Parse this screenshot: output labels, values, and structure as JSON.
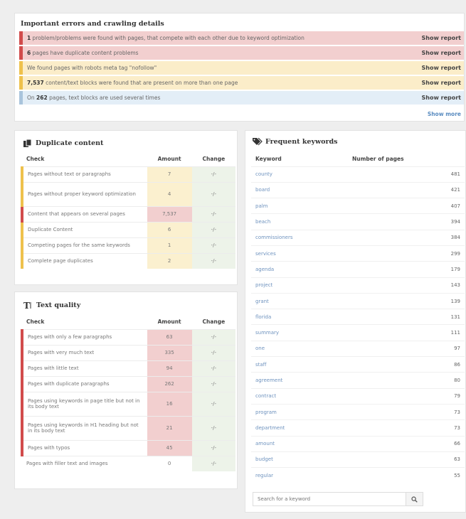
{
  "errors": {
    "title": "Important errors and crawling details",
    "show_label": "Show report",
    "show_more": "Show more",
    "rows": [
      {
        "bold": "1",
        "text": " problem/problems were found with pages, that compete with each other due to keyword optimization",
        "status": "red"
      },
      {
        "bold": "6",
        "text": " pages have duplicate content problems",
        "status": "red"
      },
      {
        "bold": "",
        "text": "We found pages with robots meta tag \"nofollow\"",
        "status": "yellow"
      },
      {
        "bold": "7,537",
        "text": " content/text blocks were found that are present on more than one page",
        "status": "yellow"
      },
      {
        "bold": "262",
        "text": " pages, text blocks are used several times",
        "prefix": "On ",
        "status": "blue"
      }
    ]
  },
  "duplicate": {
    "title": "Duplicate content",
    "col_check": "Check",
    "col_amount": "Amount",
    "col_change": "Change",
    "rows": [
      {
        "check": "Pages without text or paragraphs",
        "amount": "7",
        "change": "-/-",
        "status": "yellow"
      },
      {
        "check": "Pages without proper keyword optimization",
        "amount": "4",
        "change": "-/-",
        "status": "yellow"
      },
      {
        "check": "Content that appears on several pages",
        "amount": "7,537",
        "change": "-/-",
        "status": "red"
      },
      {
        "check": "Duplicate Content",
        "amount": "6",
        "change": "-/-",
        "status": "yellow"
      },
      {
        "check": "Competing pages for the same keywords",
        "amount": "1",
        "change": "-/-",
        "status": "yellow"
      },
      {
        "check": "Complete page duplicates",
        "amount": "2",
        "change": "-/-",
        "status": "yellow"
      }
    ]
  },
  "text_quality": {
    "title": "Text quality",
    "col_check": "Check",
    "col_amount": "Amount",
    "col_change": "Change",
    "rows": [
      {
        "check": "Pages with only a few paragraphs",
        "amount": "63",
        "change": "-/-",
        "status": "red"
      },
      {
        "check": "Pages with very much text",
        "amount": "335",
        "change": "-/-",
        "status": "red"
      },
      {
        "check": "Pages with little text",
        "amount": "94",
        "change": "-/-",
        "status": "red"
      },
      {
        "check": "Pages with duplicate paragraphs",
        "amount": "262",
        "change": "-/-",
        "status": "red"
      },
      {
        "check": "Pages using keywords in page title but not in its body text",
        "amount": "16",
        "change": "-/-",
        "status": "red"
      },
      {
        "check": "Pages using keywords in H1 heading but not in its body text",
        "amount": "21",
        "change": "-/-",
        "status": "red"
      },
      {
        "check": "Pages with typos",
        "amount": "45",
        "change": "-/-",
        "status": "red"
      },
      {
        "check": "Pages with filler text and images",
        "amount": "0",
        "change": "-/-",
        "status": "none"
      }
    ]
  },
  "keywords": {
    "title": "Frequent keywords",
    "col_keyword": "Keyword",
    "col_pages": "Number of pages",
    "search_placeholder": "Search for a keyword",
    "rows": [
      {
        "keyword": "county",
        "pages": "481"
      },
      {
        "keyword": "board",
        "pages": "421"
      },
      {
        "keyword": "palm",
        "pages": "407"
      },
      {
        "keyword": "beach",
        "pages": "394"
      },
      {
        "keyword": "commissioners",
        "pages": "384"
      },
      {
        "keyword": "services",
        "pages": "299"
      },
      {
        "keyword": "agenda",
        "pages": "179"
      },
      {
        "keyword": "project",
        "pages": "143"
      },
      {
        "keyword": "grant",
        "pages": "139"
      },
      {
        "keyword": "florida",
        "pages": "131"
      },
      {
        "keyword": "summary",
        "pages": "111"
      },
      {
        "keyword": "one",
        "pages": "97"
      },
      {
        "keyword": "staff",
        "pages": "86"
      },
      {
        "keyword": "agreement",
        "pages": "80"
      },
      {
        "keyword": "contract",
        "pages": "79"
      },
      {
        "keyword": "program",
        "pages": "73"
      },
      {
        "keyword": "department",
        "pages": "73"
      },
      {
        "keyword": "amount",
        "pages": "66"
      },
      {
        "keyword": "budget",
        "pages": "63"
      },
      {
        "keyword": "regular",
        "pages": "55"
      }
    ]
  }
}
